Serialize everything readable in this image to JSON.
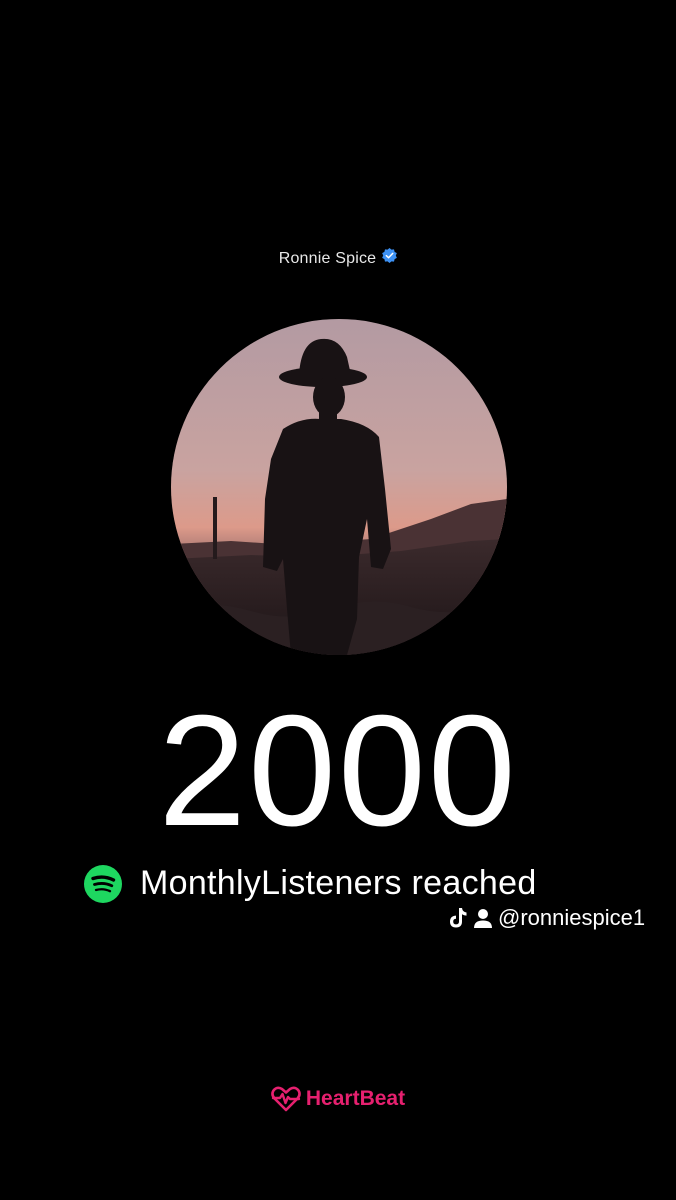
{
  "artist": {
    "name": "Ronnie Spice",
    "verified_color": "#3d91f4"
  },
  "milestone": {
    "count": "2000",
    "label": "MonthlyListeners reached",
    "platform_icon": "spotify-icon",
    "platform_color": "#1ed760"
  },
  "social": {
    "icons": [
      "tiktok-icon",
      "person-icon"
    ],
    "handle": "@ronniespice1"
  },
  "brand": {
    "icon": "heartbeat-icon",
    "name": "HeartBeat",
    "color": "#e6206f"
  },
  "colors": {
    "background": "#000000",
    "sky_top": "#b8a0a6",
    "sky_bottom": "#d89a8e"
  }
}
